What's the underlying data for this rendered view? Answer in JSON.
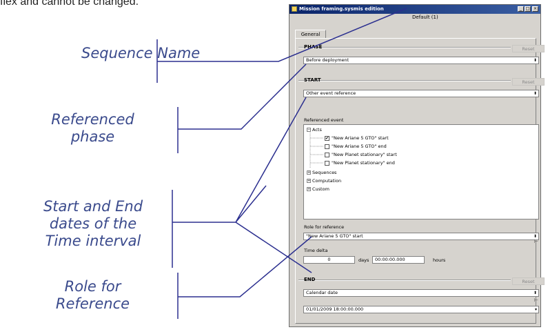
{
  "caption": "flex and cannot be changed.",
  "callouts": [
    {
      "text": "Sequence Name"
    },
    {
      "line1": "Referenced",
      "line2": "phase"
    },
    {
      "line1": "Start and End",
      "line2": "dates of the",
      "line3": "Time interval"
    },
    {
      "line1": "Role for",
      "line2": "Reference"
    }
  ],
  "window": {
    "title": "Mission framing.sysmis edition",
    "sequence_name": "Default (1)",
    "tab": "General",
    "phase": {
      "label": "PHASE",
      "reset": "Reset",
      "value": "Before deployment"
    },
    "start": {
      "label": "START",
      "reset": "Reset",
      "value": "Other event reference"
    },
    "referenced_event_label": "Referenced event",
    "tree": {
      "acts": "Acts",
      "items": [
        {
          "label": "\"New Ariane 5 GTO\" start",
          "checked": true
        },
        {
          "label": "\"New Ariane 5 GTO\" end",
          "checked": false
        },
        {
          "label": "\"New Planet stationary\" start",
          "checked": false
        },
        {
          "label": "\"New Planet stationary\" end",
          "checked": false
        }
      ],
      "sequences": "Sequences",
      "computation": "Computation",
      "custom": "Custom"
    },
    "role_label": "Role for reference",
    "role_value": "\"New Ariane 5 GTO\" start",
    "time_delta_label": "Time delta",
    "days_value": "0",
    "days_label": "days",
    "hours_value": "00:00:00.000",
    "hours_label": "hours",
    "end": {
      "label": "END",
      "reset": "Reset",
      "value": "Calendar date"
    },
    "date_value": "01/01/2009 18:00:00.000"
  },
  "colors": {
    "callout": "#3a4a8c",
    "line": "#2b2f8f",
    "titlebar": "#0a246a"
  }
}
